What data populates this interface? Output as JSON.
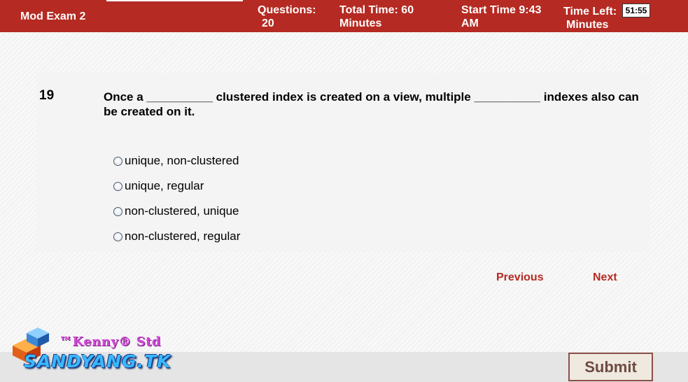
{
  "header": {
    "title": "Mod Exam 2",
    "questions_label": "Questions:",
    "questions_value": "20",
    "total_time_label": "Total Time:  60",
    "total_time_unit": "Minutes",
    "start_time_label": "Start Time  9:43",
    "start_time_ampm": "AM",
    "time_left_label": "Time Left:",
    "time_left_unit": "Minutes",
    "timer": "51:55"
  },
  "question": {
    "number": "19",
    "text": "Once a __________ clustered index is created on a view, multiple __________ indexes also can be created on it.",
    "options": [
      "unique, non-clustered",
      "unique, regular",
      "non-clustered, unique",
      "non-clustered, regular"
    ]
  },
  "navigation": {
    "previous": "Previous",
    "next": "Next",
    "submit": "Submit"
  },
  "logo": {
    "tagline": "™Kenny® Std",
    "site": "SANDYANG.TK"
  },
  "colors": {
    "header_bg": "#b52a22",
    "nav_link": "#b52a22",
    "panel_bg": "#f4f4f4"
  }
}
